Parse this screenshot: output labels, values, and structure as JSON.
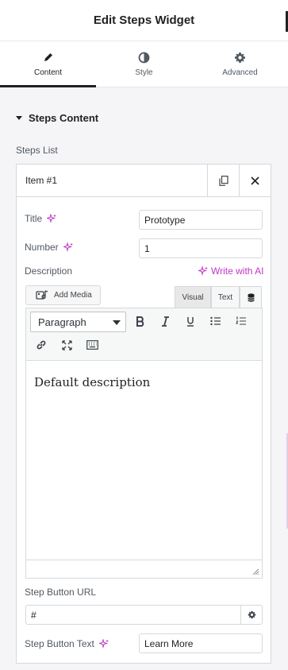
{
  "header": {
    "title": "Edit Steps Widget"
  },
  "tabs": [
    {
      "label": "Content",
      "icon": "pencil-icon",
      "active": true
    },
    {
      "label": "Style",
      "icon": "half-circle-icon",
      "active": false
    },
    {
      "label": "Advanced",
      "icon": "gear-icon",
      "active": false
    }
  ],
  "section": {
    "title": "Steps Content"
  },
  "steps_list": {
    "label": "Steps List",
    "item": {
      "title": "Item #1",
      "fields": {
        "title": {
          "label": "Title",
          "value": "Prototype"
        },
        "number": {
          "label": "Number",
          "value": "1"
        },
        "description": {
          "label": "Description",
          "write_ai": "Write with AI",
          "add_media": "Add Media",
          "tab_visual": "Visual",
          "tab_text": "Text",
          "format": "Paragraph",
          "content": "Default description"
        },
        "button_url": {
          "label": "Step Button URL",
          "value": "#"
        },
        "button_text": {
          "label": "Step Button Text",
          "value": "Learn More"
        }
      }
    }
  },
  "colors": {
    "accent_ai": "#c036c6",
    "text": "#1f2124",
    "border": "#d5d8dc"
  }
}
